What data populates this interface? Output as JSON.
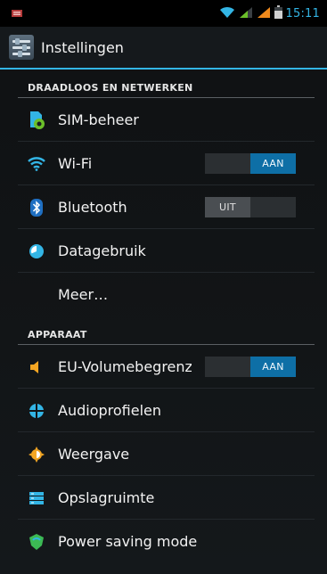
{
  "status_bar": {
    "time": "15:11",
    "icons": [
      "notification-icon",
      "wifi-signal-icon",
      "cell-signal-1-icon",
      "cell-signal-2-icon",
      "battery-icon"
    ]
  },
  "action_bar": {
    "title": "Instellingen",
    "icon": "settings-app-icon"
  },
  "sections": [
    {
      "header": "DRAADLOOS EN NETWERKEN",
      "items": [
        {
          "label": "SIM-beheer",
          "icon": "sim-manager-icon"
        },
        {
          "label": "Wi-Fi",
          "icon": "wifi-icon",
          "toggle": {
            "state": "on",
            "label": "AAN"
          }
        },
        {
          "label": "Bluetooth",
          "icon": "bluetooth-icon",
          "toggle": {
            "state": "off",
            "label": "UIT"
          }
        },
        {
          "label": "Datagebruik",
          "icon": "data-usage-icon"
        },
        {
          "label": "Meer…",
          "icon": null
        }
      ]
    },
    {
      "header": "APPARAAT",
      "items": [
        {
          "label": "EU-Volumebegrenzing",
          "icon": "volume-icon",
          "toggle": {
            "state": "on",
            "label": "AAN"
          }
        },
        {
          "label": "Audioprofielen",
          "icon": "audio-profiles-icon"
        },
        {
          "label": "Weergave",
          "icon": "display-icon"
        },
        {
          "label": "Opslagruimte",
          "icon": "storage-icon"
        },
        {
          "label": "Power saving mode",
          "icon": "power-saving-icon"
        }
      ]
    }
  ],
  "colors": {
    "accent": "#33b5e5",
    "toggle_on": "#0e6fa6",
    "toggle_off": "#4a4e52",
    "volume_icon": "#f5a623",
    "power_icon": "#3cba54"
  }
}
